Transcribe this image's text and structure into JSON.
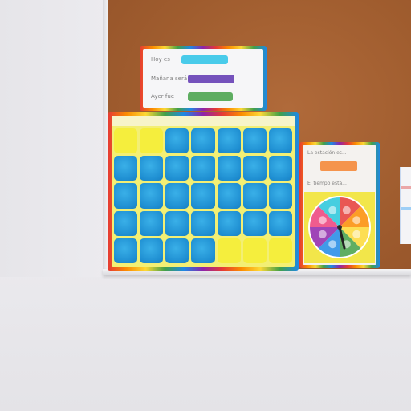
{
  "scene": {
    "subject": "",
    "colors": {
      "wall": "#e9e8ec",
      "corkboard": "#a3602f",
      "calendar_yellow": "#f3ef74",
      "day_blue": "#2196d8",
      "pill_cyan": "#26c6da",
      "pill_purple": "#5e35b1",
      "pill_green": "#43a047",
      "pill_orange": "#f58a3a"
    }
  },
  "header_card": {
    "lines": [
      {
        "label": "Hoy es",
        "pill": "",
        "color": "#2ac3e8"
      },
      {
        "label": "Mañana será",
        "pill": "",
        "color": "#5e35b1"
      },
      {
        "label": "Ayer fue",
        "pill": "",
        "color": "#43a047"
      }
    ]
  },
  "calendar": {
    "header_text": "",
    "rows": [
      [
        "empty",
        "empty",
        "blue",
        "blue",
        "blue",
        "blue",
        "blue"
      ],
      [
        "blue",
        "blue",
        "blue",
        "blue",
        "blue",
        "blue",
        "blue"
      ],
      [
        "blue",
        "blue",
        "blue",
        "blue",
        "blue",
        "blue",
        "blue"
      ],
      [
        "blue",
        "blue",
        "blue",
        "blue",
        "blue",
        "blue",
        "blue"
      ],
      [
        "blue",
        "blue",
        "blue",
        "blue",
        "empty",
        "empty",
        "empty"
      ]
    ]
  },
  "weather_card": {
    "title": "La estación es...",
    "season_pill": "",
    "subtitle": "El tiempo está...",
    "wheel_colors": [
      "#e53935",
      "#fb8c00",
      "#fdd835",
      "#43a047",
      "#1e88e5",
      "#8e24aa",
      "#ec407a",
      "#26c6da"
    ]
  }
}
